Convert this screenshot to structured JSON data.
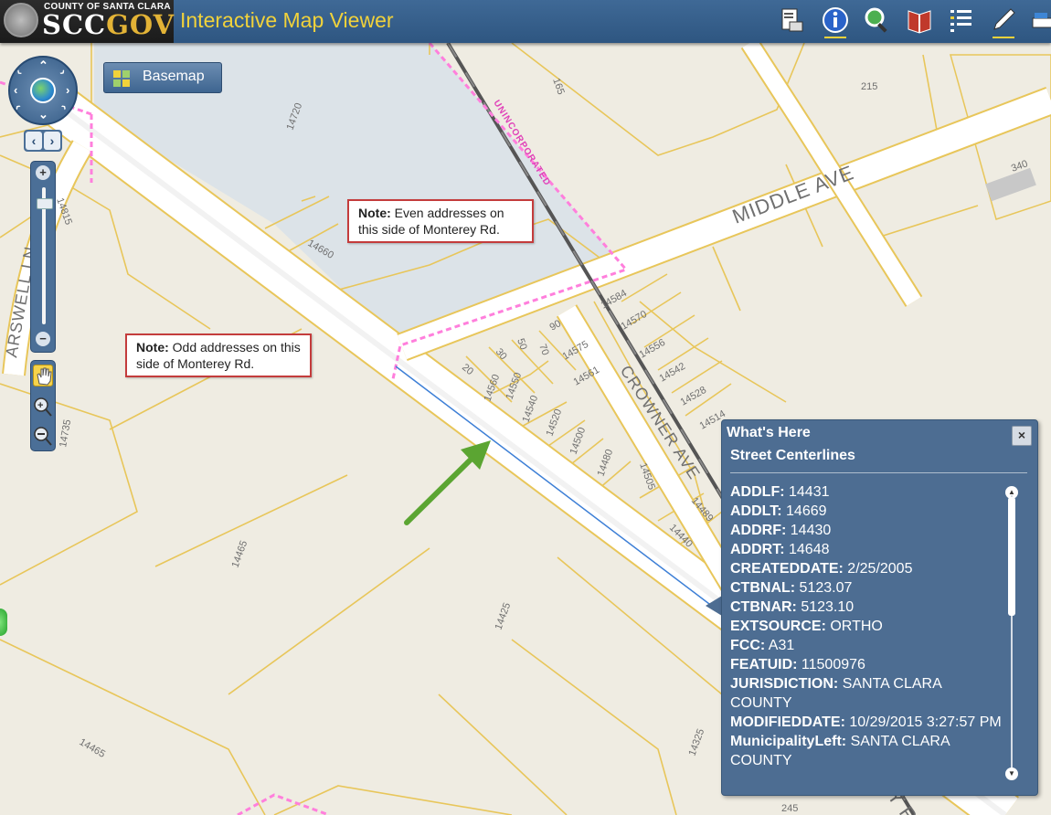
{
  "header": {
    "logo_county": "COUNTY OF SANTA CLARA",
    "logo_scc": "SCC",
    "logo_gov": "GOV",
    "app_title": "Interactive Map Viewer",
    "tools": [
      "print-icon",
      "info-icon",
      "search-icon",
      "bookmark-icon",
      "layers-list-icon",
      "draw-icon",
      "measure-icon"
    ]
  },
  "map": {
    "basemap_label": "Basemap",
    "street_labels": [
      "MIDDLE AVE",
      "CROWNER AVE",
      "ARSWELL LN",
      "UNINCORPORATED",
      "MONTEREY RD"
    ],
    "parcel_labels": [
      "14720",
      "165",
      "215",
      "340",
      "14815",
      "14660",
      "14584",
      "14570",
      "14556",
      "14542",
      "14528",
      "14514",
      "14575",
      "14561",
      "90",
      "70",
      "50",
      "30",
      "20",
      "14560",
      "14550",
      "14540",
      "14520",
      "14500",
      "14480",
      "14505",
      "14489",
      "14440",
      "14465",
      "14425",
      "14735",
      "14465",
      "14325",
      "245"
    ]
  },
  "notes": {
    "even": {
      "bold": "Note:",
      "text": " Even addresses on this side of Monterey Rd."
    },
    "odd": {
      "bold": "Note:",
      "text": " Odd addresses on this side of Monterey Rd."
    }
  },
  "popup": {
    "title": "What's Here",
    "close": "×",
    "layer": "Street Centerlines",
    "attributes": [
      {
        "key": "ADDLF:",
        "value": "14431"
      },
      {
        "key": "ADDLT:",
        "value": "14669"
      },
      {
        "key": "ADDRF:",
        "value": "14430"
      },
      {
        "key": "ADDRT:",
        "value": "14648"
      },
      {
        "key": "CREATEDDATE:",
        "value": "2/25/2005"
      },
      {
        "key": "CTBNAL:",
        "value": "5123.07"
      },
      {
        "key": "CTBNAR:",
        "value": "5123.10"
      },
      {
        "key": "EXTSOURCE:",
        "value": "ORTHO"
      },
      {
        "key": "FCC:",
        "value": "A31"
      },
      {
        "key": "FEATUID:",
        "value": "11500976"
      },
      {
        "key": "JURISDICTION:",
        "value": "SANTA CLARA COUNTY"
      },
      {
        "key": "MODIFIEDDATE:",
        "value": "10/29/2015 3:27:57 PM"
      },
      {
        "key": "MunicipalityLeft:",
        "value": "SANTA CLARA COUNTY"
      }
    ]
  },
  "colors": {
    "header": "#34608c",
    "title": "#f1d23b",
    "parcel_line": "#e8c65a",
    "road_fill": "#ffffff",
    "boundary": "#ff6fd8",
    "arrow": "#5ba532",
    "popup": "#4d6d92"
  }
}
